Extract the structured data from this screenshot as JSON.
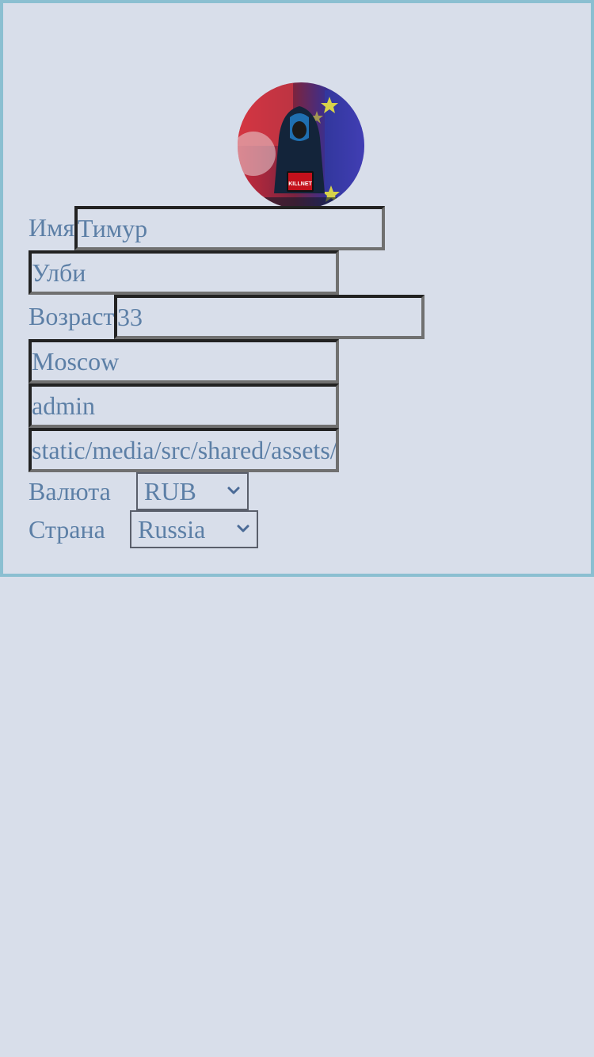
{
  "profile": {
    "avatar_text": "KILLNET",
    "first_name_label": "Имя",
    "first_name_value": "Тимур",
    "last_name_value": "Улби",
    "age_label": "Возраст",
    "age_value": "33",
    "city_value": "Moscow",
    "username_value": "admin",
    "avatar_path_value": "static/media/src/shared/assets/",
    "currency_label": "Валюта",
    "currency_value": "RUB",
    "country_label": "Страна",
    "country_value": "Russia"
  },
  "colors": {
    "background": "#d8deea",
    "card_border": "#8bbfd1",
    "text": "#5c7fa6"
  }
}
